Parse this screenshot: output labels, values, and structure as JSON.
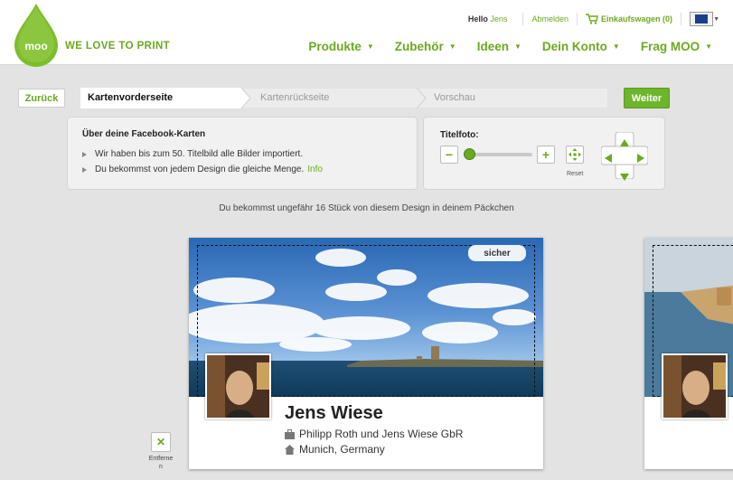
{
  "header": {
    "logo_text": "moo",
    "tagline": "WE LOVE TO PRINT",
    "greeting": "Hello",
    "username": "Jens",
    "logout_label": "Abmelden",
    "cart_label": "Einkaufswagen (0)",
    "language_flag_icon": "eu-flag-icon"
  },
  "nav": {
    "items": [
      {
        "label": "Produkte"
      },
      {
        "label": "Zubehör"
      },
      {
        "label": "Ideen"
      },
      {
        "label": "Dein Konto"
      },
      {
        "label": "Frag MOO"
      }
    ]
  },
  "wizard": {
    "back_label": "Zurück",
    "next_label": "Weiter",
    "steps": [
      {
        "label": "Kartenvorderseite",
        "active": true
      },
      {
        "label": "Kartenrückseite",
        "active": false
      },
      {
        "label": "Vorschau",
        "active": false
      }
    ]
  },
  "info_panel": {
    "title": "Über deine Facebook-Karten",
    "items": [
      "Wir haben bis zum 50. Titelbild alle Bilder importiert.",
      "Du bekommst von jedem Design die gleiche Menge."
    ],
    "link_label": "Info"
  },
  "controls": {
    "title": "Titelfoto:",
    "minus_label": "−",
    "plus_label": "+",
    "reset_label": "Reset",
    "zoom_level": 0
  },
  "count_text": "Du bekommst ungefähr 16 Stück von diesem Design in deinem Päckchen",
  "card": {
    "safe_label": "sicher",
    "name": "Jens Wiese",
    "company": "Philipp Roth und Jens Wiese GbR",
    "location": "Munich, Germany"
  },
  "remove": {
    "icon": "x-icon",
    "label": "Entferne\nn"
  },
  "colors": {
    "accent": "#6aaa1f",
    "accent_button": "#6db52a",
    "background": "#e3e3e3"
  }
}
